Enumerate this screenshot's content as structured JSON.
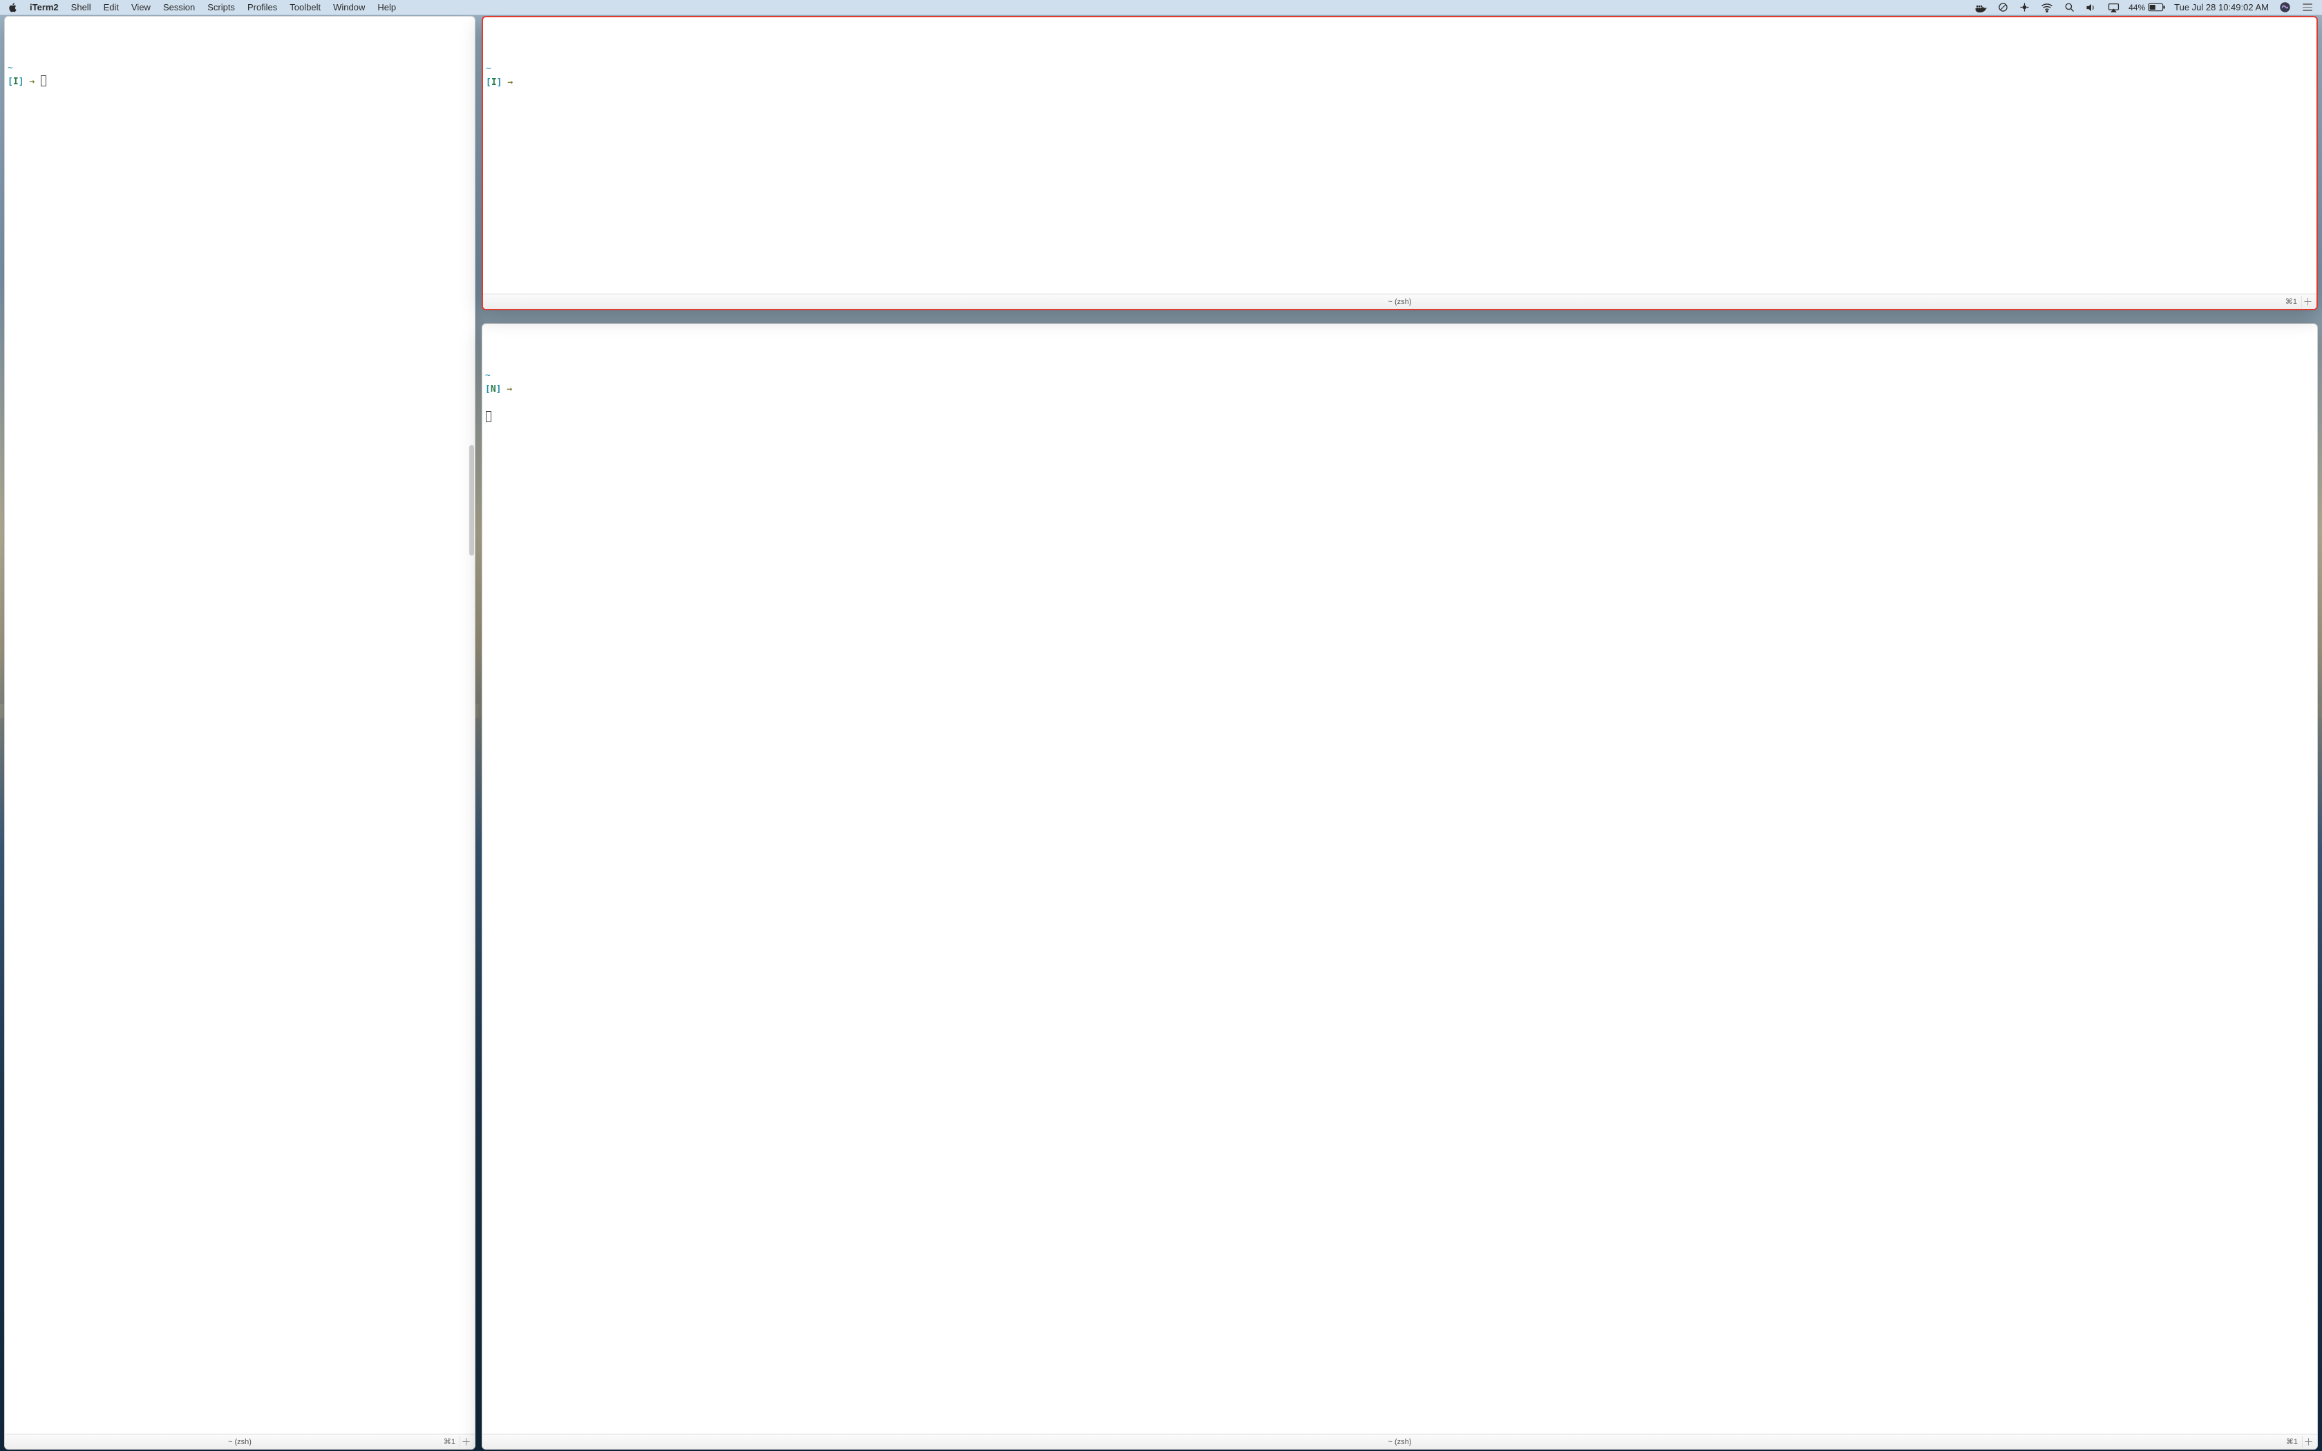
{
  "menubar": {
    "app": "iTerm2",
    "items": [
      "Shell",
      "Edit",
      "View",
      "Session",
      "Scripts",
      "Profiles",
      "Toolbelt",
      "Window",
      "Help"
    ],
    "battery_pct": "44%",
    "clock": "Tue Jul 28  10:49:02 AM"
  },
  "panes": {
    "left": {
      "path": "~",
      "mode": "I",
      "arrow": "→",
      "tab_title": "~ (zsh)",
      "tab_shortcut": "⌘1",
      "show_cursor": true
    },
    "top_right": {
      "path": "~",
      "mode": "I",
      "arrow": "→",
      "tab_title": "~ (zsh)",
      "tab_shortcut": "⌘1",
      "show_cursor": false,
      "active": true
    },
    "bottom_right": {
      "path": "~",
      "mode": "N",
      "arrow": "→",
      "tab_title": "~ (zsh)",
      "tab_shortcut": "⌘1",
      "show_cursor_below": true
    }
  }
}
